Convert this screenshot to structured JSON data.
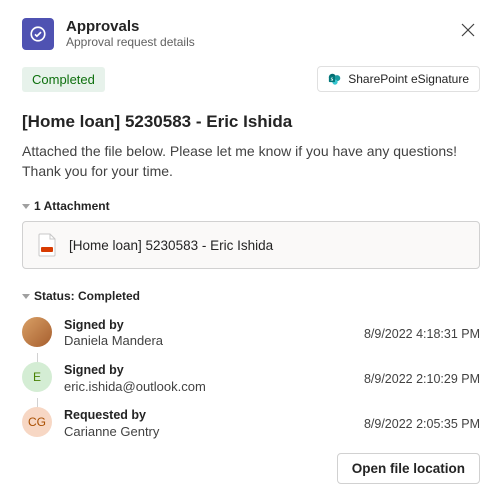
{
  "header": {
    "title": "Approvals",
    "subtitle": "Approval request details"
  },
  "status": {
    "label": "Completed"
  },
  "provider": {
    "label": "SharePoint eSignature"
  },
  "request": {
    "title": "[Home loan] 5230583 - Eric Ishida",
    "description": "Attached the file below. Please let me know if you have any questions! Thank you for your time."
  },
  "attachments": {
    "section_label": "1 Attachment",
    "items": [
      {
        "name": "[Home loan] 5230583 - Eric Ishida"
      }
    ]
  },
  "timeline": {
    "section_label": "Status: Completed",
    "entries": [
      {
        "action": "Signed by",
        "actor": "Daniela Mandera",
        "time": "8/9/2022 4:18:31 PM",
        "avatar_initials": "",
        "avatar_class": "photo"
      },
      {
        "action": "Signed by",
        "actor": "eric.ishida@outlook.com",
        "time": "8/9/2022 2:10:29 PM",
        "avatar_initials": "E",
        "avatar_class": "green"
      },
      {
        "action": "Requested by",
        "actor": "Carianne Gentry",
        "time": "8/9/2022 2:05:35 PM",
        "avatar_initials": "CG",
        "avatar_class": "orange"
      }
    ]
  },
  "footer": {
    "open_location_label": "Open file location"
  }
}
